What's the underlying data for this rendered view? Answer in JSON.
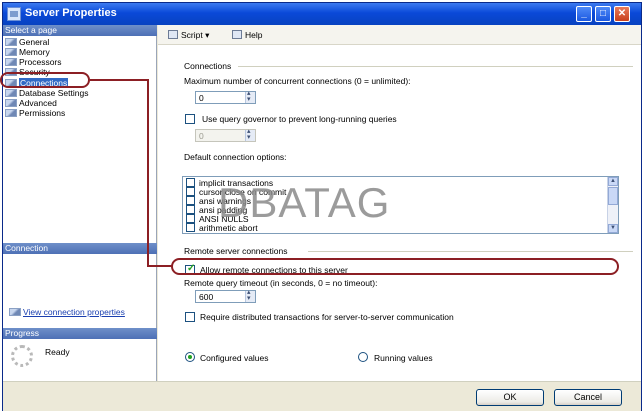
{
  "window": {
    "title": "Server Properties",
    "buttons": {
      "minimize": "_",
      "maximize": "□",
      "close": "✕"
    }
  },
  "left_panel": {
    "select_page_header": "Select a page",
    "pages": [
      "General",
      "Memory",
      "Processors",
      "Security",
      "Connections",
      "Database Settings",
      "Advanced",
      "Permissions"
    ],
    "selected_page": "Connections",
    "connection_header": "Connection",
    "view_connection_properties": "View connection properties",
    "progress_header": "Progress",
    "progress_status": "Ready"
  },
  "toolbar": {
    "script_label": "Script",
    "help_label": "Help"
  },
  "connections": {
    "group_label": "Connections",
    "max_connections_label": "Maximum number of concurrent connections (0 = unlimited):",
    "max_connections_value": "0",
    "use_query_governor_label": "Use query governor to prevent long-running queries",
    "query_governor_value": "0",
    "default_options_label": "Default connection options:",
    "default_options": [
      {
        "label": "implicit transactions",
        "checked": false
      },
      {
        "label": "cursor close on commit",
        "checked": false
      },
      {
        "label": "ansi warnings",
        "checked": false
      },
      {
        "label": "ansi padding",
        "checked": false
      },
      {
        "label": "ANSI NULLS",
        "checked": false
      },
      {
        "label": "arithmetic abort",
        "checked": false
      }
    ]
  },
  "remote": {
    "group_label": "Remote server connections",
    "allow_remote_label": "Allow remote connections to this server",
    "allow_remote_checked": true,
    "timeout_label": "Remote query timeout (in seconds, 0 = no timeout):",
    "timeout_value": "600",
    "distributed_label": "Require distributed transactions for server-to-server communication"
  },
  "view_mode": {
    "configured_label": "Configured values",
    "running_label": "Running values",
    "selected": "configured"
  },
  "watermark": "DBATAG",
  "buttons": {
    "ok_label": "OK",
    "cancel_label": "Cancel"
  },
  "colors": {
    "annotation": "#8c1f24",
    "selection": "#316ac5",
    "titlebar": "#0a49d8"
  }
}
